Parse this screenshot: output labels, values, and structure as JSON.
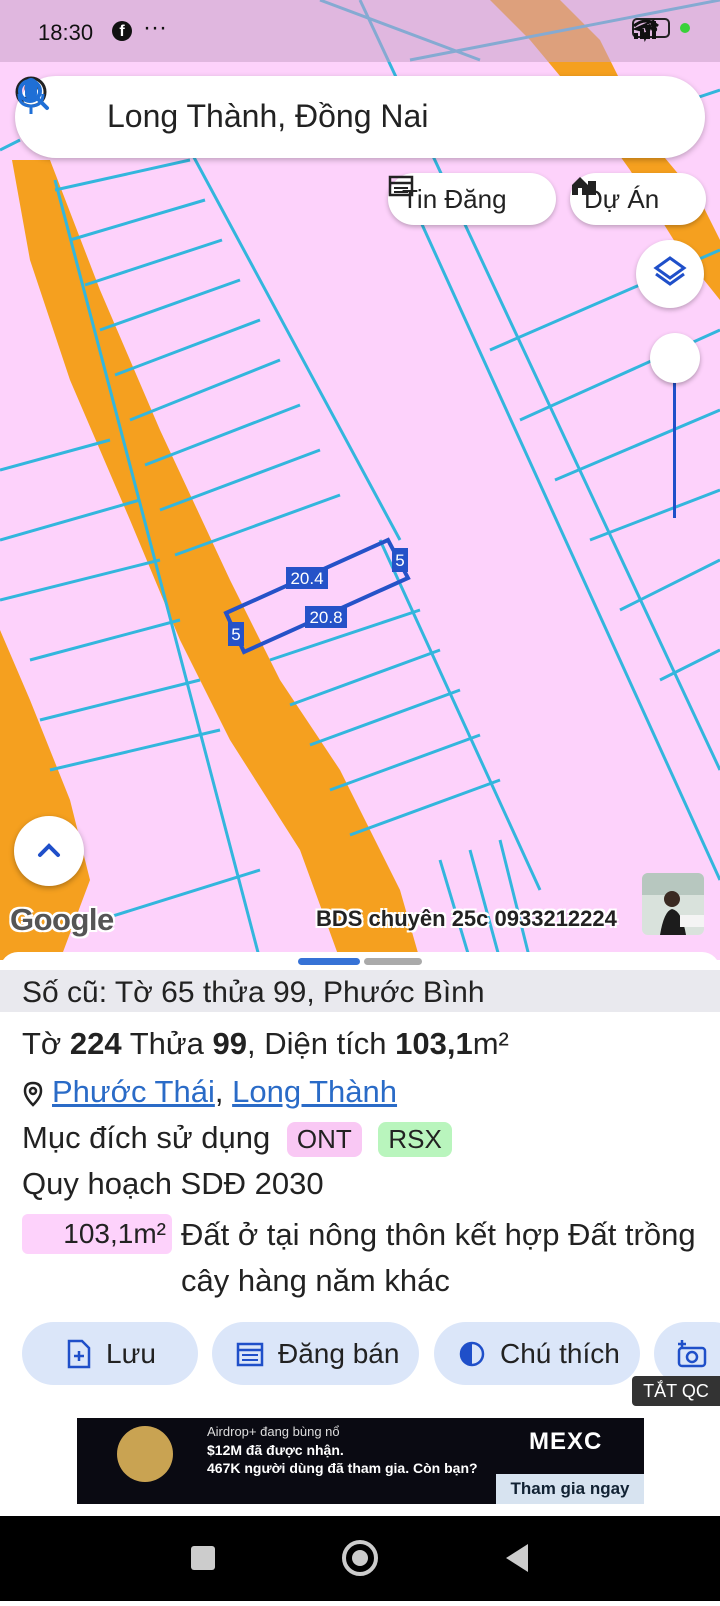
{
  "status_bar": {
    "time": "18:30",
    "battery": "65",
    "more": "···"
  },
  "search": {
    "title": "Long Thành, Đồng Nai"
  },
  "chips": {
    "listings": "Tin Đăng",
    "projects": "Dự Án"
  },
  "map": {
    "google_logo": "Google",
    "watermark": "BDS chuyên 25c 0933212224",
    "dimensions": {
      "top": "20.4",
      "bottom": "20.8",
      "left": "5",
      "right": "5"
    },
    "colors": {
      "land": "#fdd2fb",
      "road": "#f5a01f",
      "parcel_line": "#33b6dd",
      "selection": "#2552c8"
    }
  },
  "sheet": {
    "old_info": "Số cũ: Tờ 65 thửa 99, Phước Bình",
    "parcel": {
      "label_to": "Tờ",
      "to": "224",
      "label_thua": "Thửa",
      "thua": "99",
      "label_area": ", Diện tích",
      "area": "103,1",
      "unit": "m²"
    },
    "location": {
      "commune": "Phước Thái",
      "district": "Long Thành",
      "sep": ","
    },
    "purpose": {
      "label": "Mục đích sử dụng",
      "codes": [
        "ONT",
        "RSX"
      ]
    },
    "plan": {
      "title": "Quy hoạch SDĐ 2030",
      "area": "103,1m²",
      "description": "Đất ở tại nông thôn kết hợp Đất trồng cây hàng năm khác"
    },
    "actions": {
      "save": "Lưu",
      "post": "Đăng bán",
      "legend": "Chú thích"
    }
  },
  "ad": {
    "close_label": "TẮT QC",
    "line1": "Airdrop+ đang bùng nổ",
    "line2": "$12M đã được nhận.",
    "line3": "467K người dùng đã tham gia. Còn bạn?",
    "brand": "MEXC",
    "cta": "Tham gia ngay"
  }
}
